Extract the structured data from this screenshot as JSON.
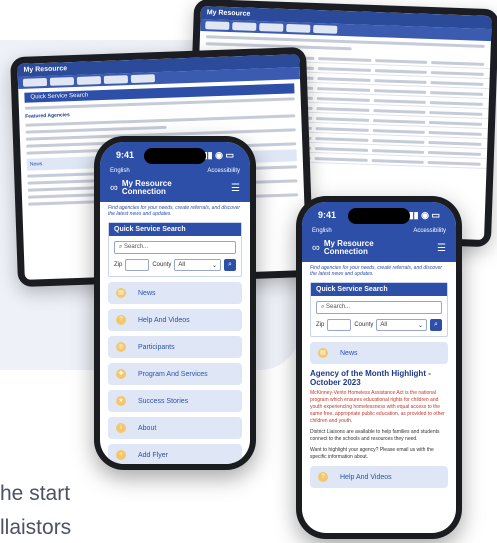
{
  "bottom_text": {
    "line1": "he start",
    "line2": "llaistors"
  },
  "app": {
    "name_line1": "My Resource",
    "name_line2": "Connection",
    "language": "English",
    "accessibility": "Accessibility",
    "status_time": "9:41",
    "tagline": "Find agencies for your needs, create referrals, and discover the latest news and updates.",
    "quick_search_title": "Quick Service Search",
    "search_placeholder": "Search...",
    "zip_label": "Zip",
    "county_label": "County",
    "county_value": "All"
  },
  "menu": [
    {
      "label": "News",
      "icon": "news-icon"
    },
    {
      "label": "Help And Videos",
      "icon": "help-icon"
    },
    {
      "label": "Participants",
      "icon": "participants-icon"
    },
    {
      "label": "Program And Services",
      "icon": "program-icon"
    },
    {
      "label": "Success Stories",
      "icon": "stories-icon"
    },
    {
      "label": "About",
      "icon": "about-icon"
    },
    {
      "label": "Add Flyer",
      "icon": "flyer-icon"
    }
  ],
  "article": {
    "title": "Agency of the Month Highlight - October 2023",
    "body1": "McKinney-Vento Homeless Assistance Act is the national program which ensures educational rights for children and youth experiencing homelessness with equal access to the same free, appropriate public education, as provided to other children and youth.",
    "body2": "District Liaisons are available to help families and students connect to the schools and resources they need.",
    "body3": "Want to highlight your agency? Please email us with the specific information about."
  },
  "tablet_front": {
    "title": "Quick Service Search",
    "section": "Featured Agencies",
    "news": "News"
  }
}
